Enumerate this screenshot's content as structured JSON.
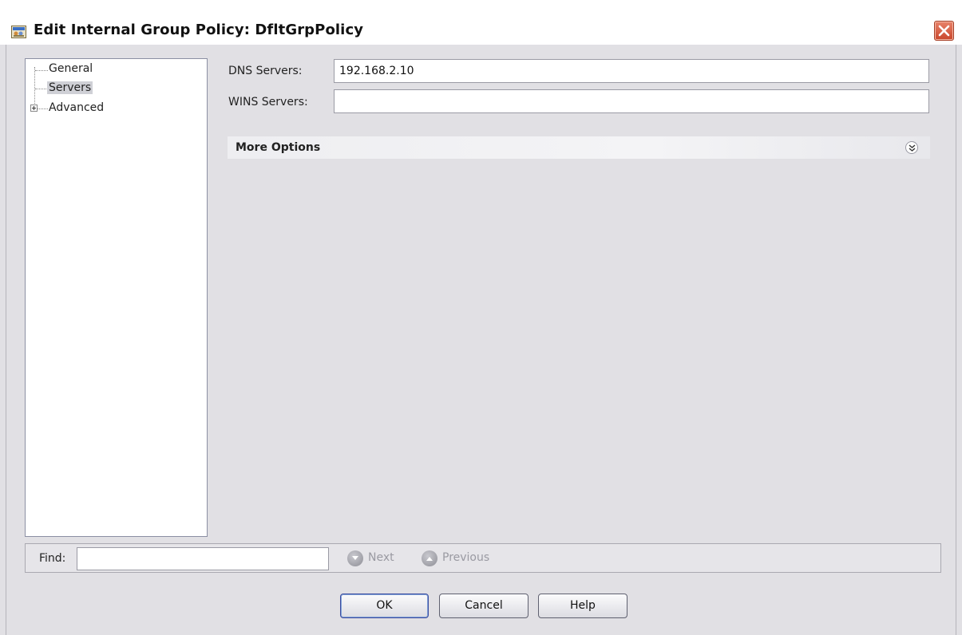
{
  "window": {
    "title": "Edit Internal Group Policy: DfltGrpPolicy"
  },
  "tree": {
    "items": [
      {
        "label": "General"
      },
      {
        "label": "Servers",
        "selected": true
      },
      {
        "label": "Advanced",
        "expandable": true
      }
    ]
  },
  "form": {
    "dns_label": "DNS Servers:",
    "dns_value": "192.168.2.10",
    "wins_label": "WINS Servers:",
    "wins_value": "",
    "more_options_label": "More Options"
  },
  "find": {
    "label": "Find:",
    "value": "",
    "next_label": "Next",
    "previous_label": "Previous"
  },
  "buttons": {
    "ok": "OK",
    "cancel": "Cancel",
    "help": "Help"
  },
  "colors": {
    "close_button": "#c9462b",
    "selection": "#cfd0d6",
    "dialog_background": "#e1e0e4"
  }
}
